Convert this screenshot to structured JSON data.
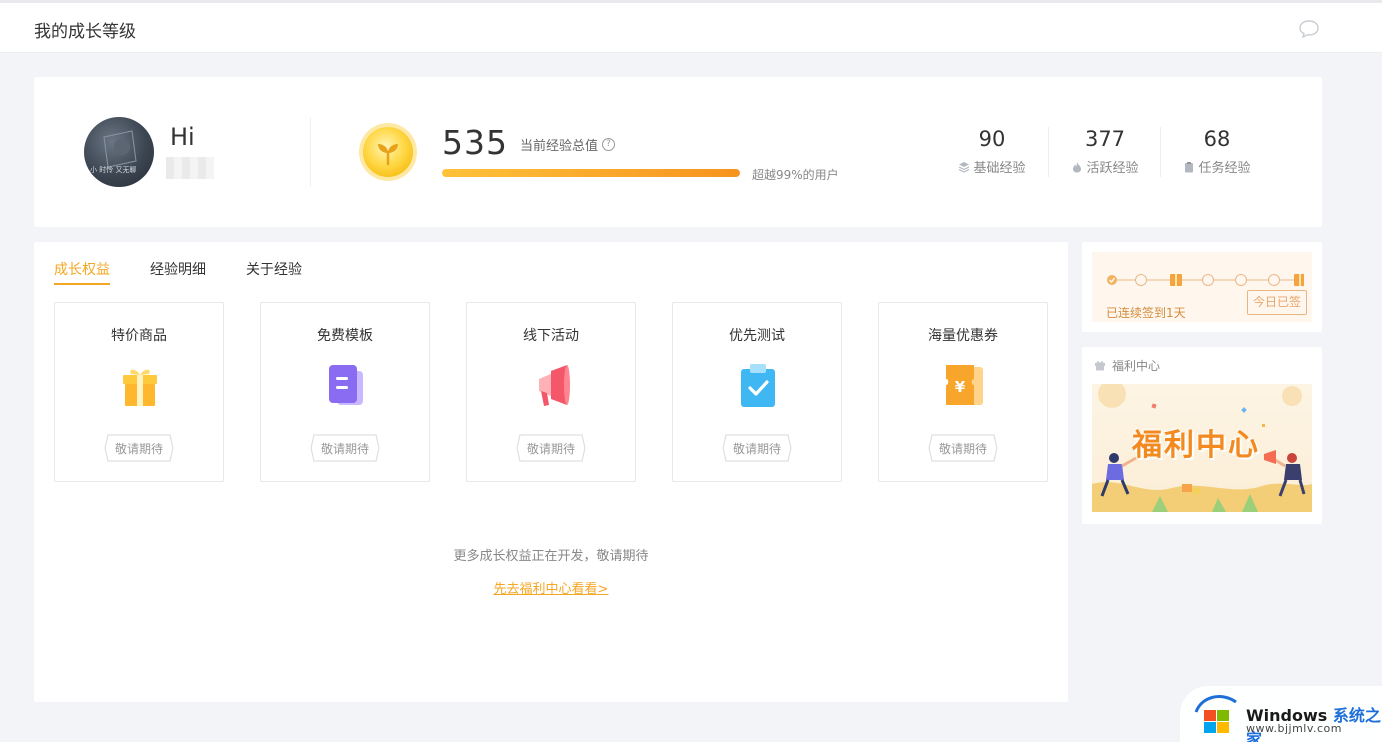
{
  "header": {
    "title": "我的成长等级",
    "chat_icon": "chat-bubble-icon"
  },
  "profile": {
    "greeting": "Hi",
    "avatar_caption": "小 时怜 又无聊",
    "exp_total": "535",
    "exp_total_label": "当前经验总值",
    "exp_progress": 1.0,
    "rank_text": "超越99%的用户",
    "stats": [
      {
        "value": "90",
        "label": "基础经验",
        "icon": "layers-icon"
      },
      {
        "value": "377",
        "label": "活跃经验",
        "icon": "flame-icon"
      },
      {
        "value": "68",
        "label": "任务经验",
        "icon": "clipboard-icon"
      }
    ]
  },
  "tabs": [
    {
      "label": "成长权益",
      "active": true
    },
    {
      "label": "经验明细",
      "active": false
    },
    {
      "label": "关于经验",
      "active": false
    }
  ],
  "benefits": [
    {
      "title": "特价商品",
      "badge": "敬请期待",
      "icon": "gift-icon"
    },
    {
      "title": "免费模板",
      "badge": "敬请期待",
      "icon": "template-icon"
    },
    {
      "title": "线下活动",
      "badge": "敬请期待",
      "icon": "megaphone-icon"
    },
    {
      "title": "优先测试",
      "badge": "敬请期待",
      "icon": "clipboard-check-icon"
    },
    {
      "title": "海量优惠券",
      "badge": "敬请期待",
      "icon": "coupon-icon"
    }
  ],
  "more_text": "更多成长权益正在开发，敬请期待",
  "welfare_link": "先去福利中心看看>",
  "checkin": {
    "status_text": "已连续签到1天",
    "button_label": "今日已签"
  },
  "welfare": {
    "title": "福利中心",
    "banner_text": "福利中心"
  },
  "watermark": {
    "brand": "Windows",
    "brand_suffix": "系统之家",
    "url": "www.bjjmlv.com"
  },
  "colors": {
    "accent": "#f5a623",
    "progress_start": "#ffc23a",
    "progress_end": "#f7931e"
  }
}
